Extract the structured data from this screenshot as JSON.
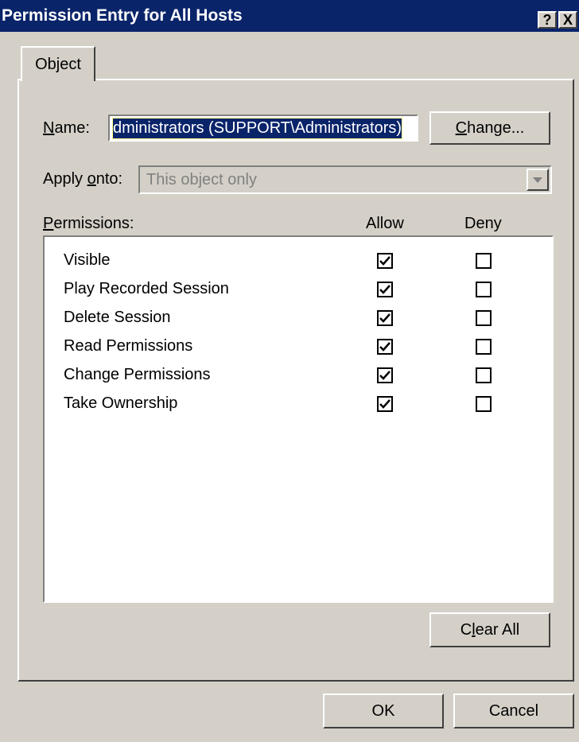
{
  "window": {
    "title": "Permission Entry for All Hosts",
    "help_label": "?",
    "close_label": "X"
  },
  "tabs": [
    {
      "label": "Object"
    }
  ],
  "name_row": {
    "label_prefix": "",
    "label_mnemonic": "N",
    "label_rest": "ame:",
    "value": "dministrators (SUPPORT\\Administrators)",
    "change_button_mnemonic": "C",
    "change_button_rest": "hange..."
  },
  "apply_onto": {
    "label_prefix": "Apply ",
    "label_mnemonic": "o",
    "label_rest": "nto:",
    "value": "This object only"
  },
  "permissions": {
    "label_mnemonic": "P",
    "label_rest": "ermissions:",
    "allow_header": "Allow",
    "deny_header": "Deny",
    "rows": [
      {
        "name": "Visible",
        "allow": true,
        "deny": false
      },
      {
        "name": "Play Recorded Session",
        "allow": true,
        "deny": false
      },
      {
        "name": "Delete Session",
        "allow": true,
        "deny": false
      },
      {
        "name": "Read Permissions",
        "allow": true,
        "deny": false
      },
      {
        "name": "Change Permissions",
        "allow": true,
        "deny": false
      },
      {
        "name": "Take Ownership",
        "allow": true,
        "deny": false
      }
    ]
  },
  "clear_all": {
    "prefix": "C",
    "mnemonic": "l",
    "rest": "ear All"
  },
  "footer": {
    "ok_label": "OK",
    "cancel_label": "Cancel"
  }
}
